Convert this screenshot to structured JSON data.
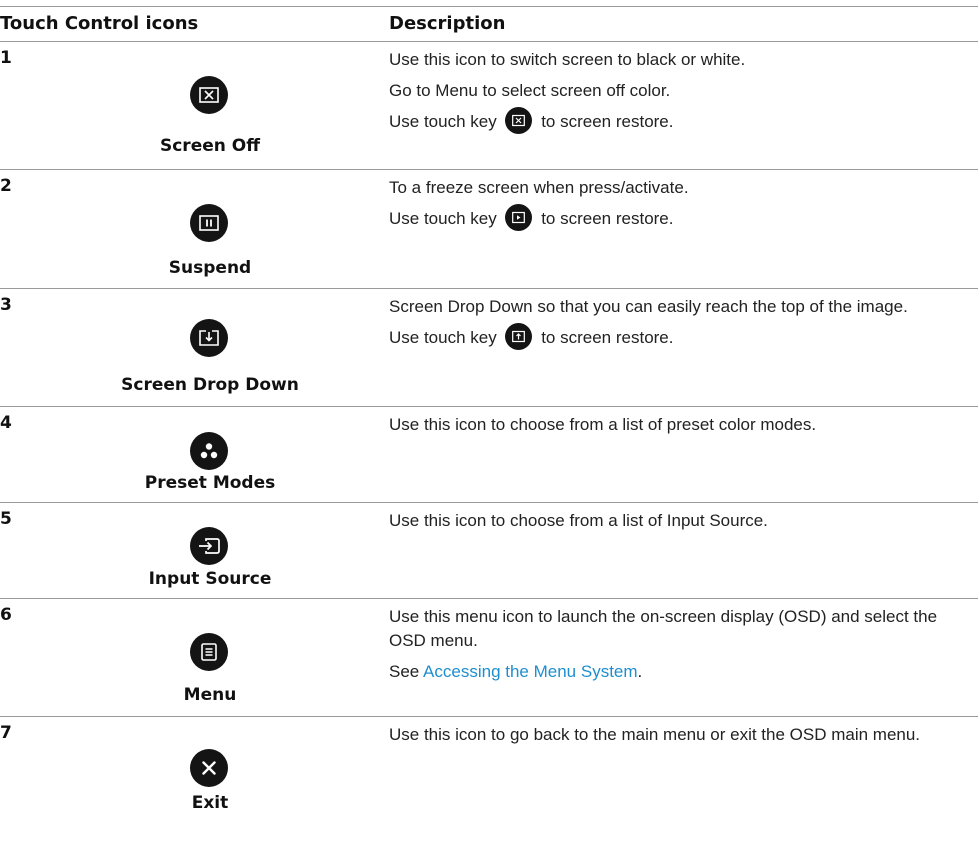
{
  "header": {
    "col1": "Touch Control icons",
    "col2": "Description"
  },
  "rows": [
    {
      "num": "1",
      "name": "Screen Off",
      "icon": "screen-off-icon",
      "lines": [
        "Use this icon to switch screen to black or white.",
        "Go to Menu to select screen off color."
      ],
      "restore_pre": "Use touch key",
      "restore_post": "to screen restore."
    },
    {
      "num": "2",
      "name": "Suspend",
      "icon": "pause-icon",
      "lines": [
        "To a freeze screen when press/activate."
      ],
      "restore_pre": "Use touch key",
      "restore_post": "to screen restore."
    },
    {
      "num": "3",
      "name": "Screen Drop Down",
      "icon": "drop-down-icon",
      "lines": [
        "Screen Drop Down so that you can easily reach the top of the image."
      ],
      "restore_pre": "Use touch key",
      "restore_post": "to screen restore."
    },
    {
      "num": "4",
      "name": "Preset Modes",
      "icon": "preset-modes-icon",
      "lines": [
        "Use this icon to choose from a list of preset color modes."
      ]
    },
    {
      "num": "5",
      "name": "Input Source",
      "icon": "input-source-icon",
      "lines": [
        "Use this icon to choose from a list of Input Source."
      ]
    },
    {
      "num": "6",
      "name": "Menu",
      "icon": "menu-icon",
      "lines": [
        "Use this menu icon to launch the on-screen display (OSD) and select the OSD menu."
      ],
      "see_pre": "See",
      "see_link": "Accessing the Menu System",
      "see_post": "."
    },
    {
      "num": "7",
      "name": "Exit",
      "icon": "exit-icon",
      "lines": [
        "Use this icon to go back to the main menu or exit the OSD main menu."
      ]
    }
  ]
}
